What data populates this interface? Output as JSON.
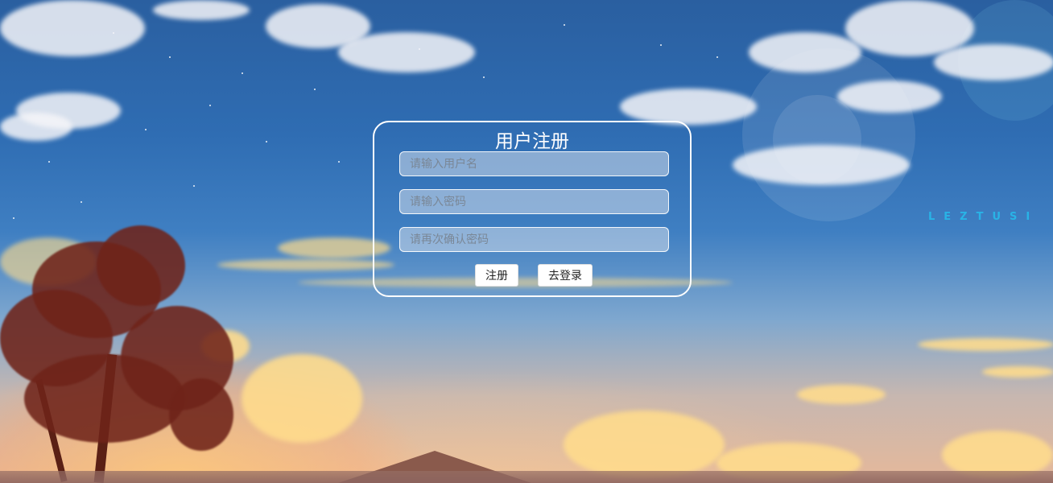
{
  "brand_text": "LEZTUSI",
  "form": {
    "title": "用户注册",
    "username_placeholder": "请输入用户名",
    "password_placeholder": "请输入密码",
    "confirm_placeholder": "请再次确认密码",
    "register_label": "注册",
    "login_label": "去登录"
  }
}
